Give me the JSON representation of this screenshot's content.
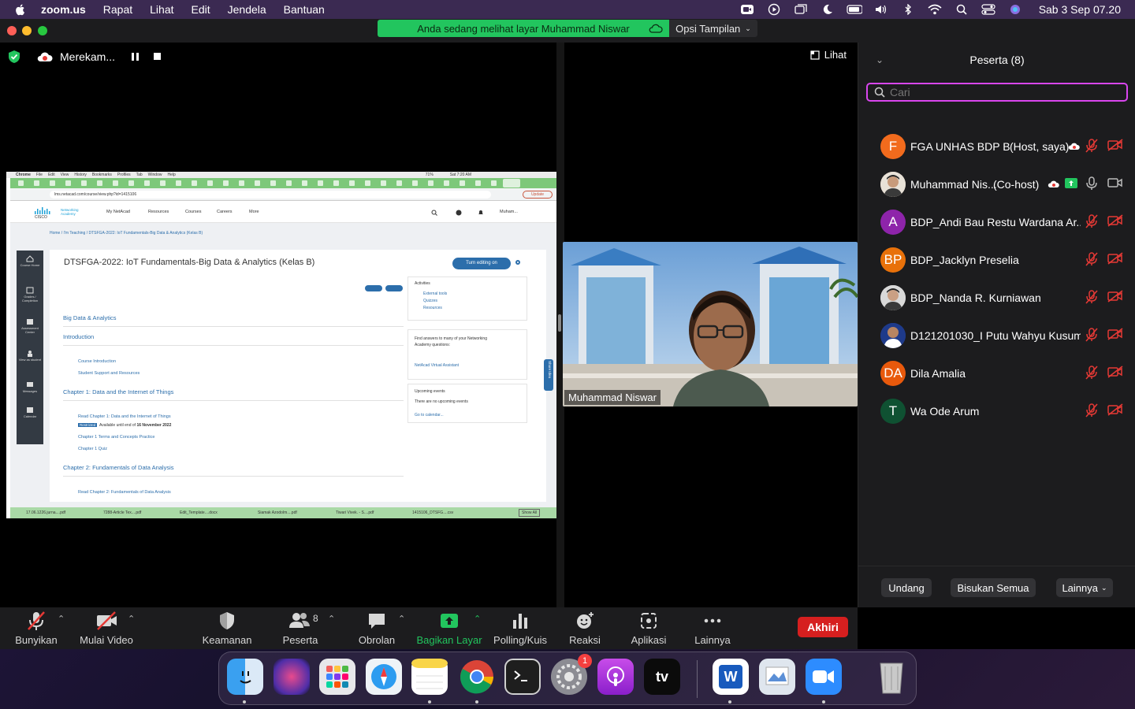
{
  "menubar": {
    "app": "zoom.us",
    "items": [
      "Rapat",
      "Lihat",
      "Edit",
      "Jendela",
      "Bantuan"
    ],
    "clock": "Sab 3 Sep  07.20"
  },
  "window": {
    "banner": "Anda sedang melihat layar Muhammad Niswar",
    "view_options": "Opsi Tampilan",
    "recording_label": "Merekam...",
    "view_button": "Lihat"
  },
  "shared_screen": {
    "menubar": [
      "Chrome",
      "File",
      "Edit",
      "View",
      "History",
      "Bookmarks",
      "Profiles",
      "Tab",
      "Window",
      "Help"
    ],
    "menubar_clock": "Sat 7:20 AM",
    "battery": "71%",
    "url": "lms.netacad.com/course/view.php?id=1415106",
    "update_btn": "Update",
    "logo_sub": "Networking Academy",
    "nav": [
      "My NetAcad",
      "Resources",
      "Courses",
      "Careers",
      "More"
    ],
    "user": "Muham...",
    "breadcrumb": "Home  /  I'm Teaching  /  DTSFGA-2022: IoT Fundamentals-Big Data & Analytics (Kelas B)",
    "sidebar": [
      "Course Home",
      "Grades / Completion",
      "Assessment Center",
      "View as student",
      "Messages",
      "Calendar"
    ],
    "title": "DTSFGA-2022: IoT Fundamentals-Big Data & Analytics (Kelas B)",
    "turn_editing": "Turn editing on",
    "sections": {
      "big_data": "Big Data & Analytics",
      "intro": "Introduction",
      "ch1": "Chapter 1: Data and the Internet of Things",
      "ch2": "Chapter 2: Fundamentals of Data Analysis"
    },
    "intro_links": [
      "Course Introduction",
      "Student Support and Resources"
    ],
    "ch1_links": {
      "read": "Read Chapter 1: Data and the Internet of Things",
      "restricted": "Restricted",
      "available": "Available until end of ",
      "available_date": "16 November 2022",
      "terms": "Chapter 1 Terms and Concepts Practice",
      "quiz": "Chapter 1 Quiz"
    },
    "ch2_read": "Read Chapter 2: Fundamentals of Data Analysis",
    "activities": {
      "title": "Activities",
      "items": [
        "External tools",
        "Quizzes",
        "Resources"
      ]
    },
    "faq": {
      "text1": "Find answers to many of your Networking",
      "text2": "Academy questions:",
      "link": "NetAcad Virtual Assistant"
    },
    "events": {
      "title": "Upcoming events",
      "none": "There are no upcoming events",
      "link": "Go to calendar..."
    },
    "share_ideas": "Share Idea",
    "downloads": [
      "17.06.1226.jurna....pdf",
      "7288-Article Tex....pdf",
      "Edit_Template....docx",
      "Siamak Azodolm....pdf",
      "Tiwari Vivek. - S....pdf",
      "1415106_DTSFG....csv"
    ],
    "show_all": "Show All"
  },
  "video": {
    "name": "Muhammad Niswar"
  },
  "participants": {
    "title": "Peserta (8)",
    "search_placeholder": "Cari",
    "list": [
      {
        "initials": "F",
        "name": "FGA UNHAS BDP B",
        "role": "(Host, saya)",
        "color": "#f26b1d"
      },
      {
        "initials": "",
        "name": "Muhammad Nis...",
        "role": "(Co-host)",
        "color": "#c9a78a"
      },
      {
        "initials": "A",
        "name": "BDP_Andi Bau Restu Wardana Ar...",
        "role": "",
        "color": "#8e24aa"
      },
      {
        "initials": "BP",
        "name": "BDP_Jacklyn Preselia",
        "role": "",
        "color": "#e8710a"
      },
      {
        "initials": "",
        "name": "BDP_Nanda R. Kurniawan",
        "role": "",
        "color": "#bcbcbc"
      },
      {
        "initials": "",
        "name": "D121201030_I Putu Wahyu Kusuma",
        "role": "",
        "color": "#1e3a8a"
      },
      {
        "initials": "DA",
        "name": "Dila Amalia",
        "role": "",
        "color": "#e8590c"
      },
      {
        "initials": "T",
        "name": "Wa Ode Arum",
        "role": "",
        "color": "#0f5132"
      }
    ],
    "invite": "Undang",
    "mute_all": "Bisukan Semua",
    "more": "Lainnya"
  },
  "toolbar": {
    "unmute": "Bunyikan",
    "start_video": "Mulai Video",
    "security": "Keamanan",
    "participants": "Peserta",
    "participants_count": "8",
    "chat": "Obrolan",
    "share": "Bagikan Layar",
    "polls": "Polling/Kuis",
    "reactions": "Reaksi",
    "apps": "Aplikasi",
    "more": "Lainnya",
    "end": "Akhiri"
  },
  "dock": {
    "icons": [
      "finder-icon",
      "siri-icon",
      "launchpad-icon",
      "safari-icon",
      "notes-icon",
      "chrome-icon",
      "terminal-icon",
      "system-preferences-icon",
      "podcasts-icon",
      "apple-tv-icon",
      "word-icon",
      "preview-icon",
      "zoom-icon",
      "trash-icon"
    ],
    "settings_badge": "1",
    "tv_label": "tv",
    "word_label": "W"
  }
}
